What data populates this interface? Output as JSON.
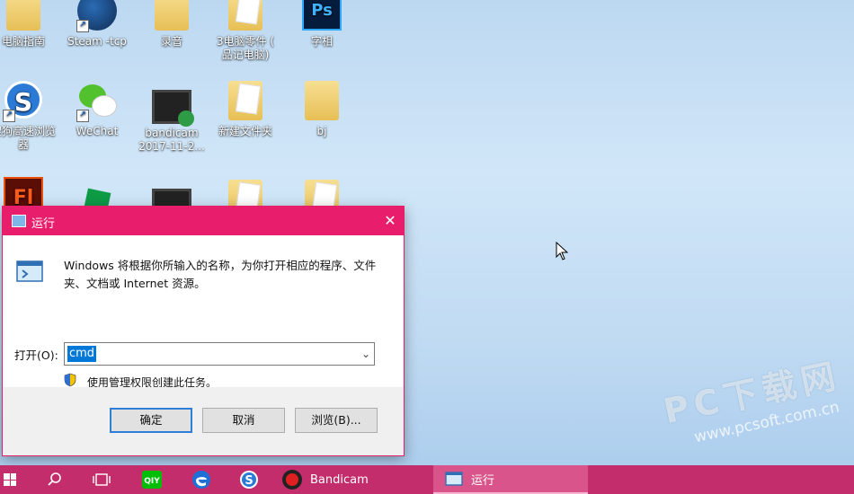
{
  "desktop": {
    "icons": [
      {
        "name": "desktop-icon-pc-guide",
        "label": "电脑指南",
        "icon": "folder-icon"
      },
      {
        "name": "desktop-icon-steam-tcp",
        "label": "Steam -tcp",
        "icon": "steam-icon"
      },
      {
        "name": "desktop-icon-luyin",
        "label": "录音",
        "icon": "folder-icon"
      },
      {
        "name": "desktop-icon-pc-parts",
        "label": "3电脑零件 (\n品记电脑)",
        "icon": "document-icon"
      },
      {
        "name": "desktop-icon-photoshop",
        "label": "字相",
        "icon": "photoshop-icon"
      },
      {
        "name": "desktop-icon-sogou-browser",
        "label": "搜狗高速浏览\n器",
        "icon": "sogou-browser-icon"
      },
      {
        "name": "desktop-icon-wechat",
        "label": "WeChat",
        "icon": "wechat-icon"
      },
      {
        "name": "desktop-icon-bandicam-video",
        "label": "bandicam\n2017-11-2...",
        "icon": "video-file-icon"
      },
      {
        "name": "desktop-icon-new-folder",
        "label": "新建文件夹",
        "icon": "folder-icon"
      },
      {
        "name": "desktop-icon-bj",
        "label": "bj",
        "icon": "folder-icon"
      },
      {
        "name": "desktop-icon-flash",
        "label": "",
        "icon": "flash-icon"
      },
      {
        "name": "desktop-icon-green-app",
        "label": "",
        "icon": "app-icon"
      },
      {
        "name": "desktop-icon-video-2",
        "label": "",
        "icon": "video-file-icon"
      },
      {
        "name": "desktop-icon-folder-4",
        "label": "",
        "icon": "folder-icon"
      },
      {
        "name": "desktop-icon-folder-5",
        "label": "",
        "icon": "folder-icon"
      }
    ]
  },
  "dialog": {
    "title": "运行",
    "close_glyph": "✕",
    "description": "Windows 将根据你所输入的名称，为你打开相应的程序、文件夹、文档或 Internet 资源。",
    "open_label": "打开(O):",
    "open_value": "cmd",
    "admin_note": "使用管理权限创建此任务。",
    "buttons": {
      "ok": "确定",
      "cancel": "取消",
      "browse": "浏览(B)..."
    }
  },
  "watermark": {
    "title": "PC下载网",
    "url": "www.pcsoft.com.cn"
  },
  "taskbar": {
    "bandicam_label": "Bandicam",
    "run_label": "运行"
  },
  "colors": {
    "accent": "#e81d6b",
    "taskbar": "#c32d6c",
    "selection": "#0078d7"
  }
}
